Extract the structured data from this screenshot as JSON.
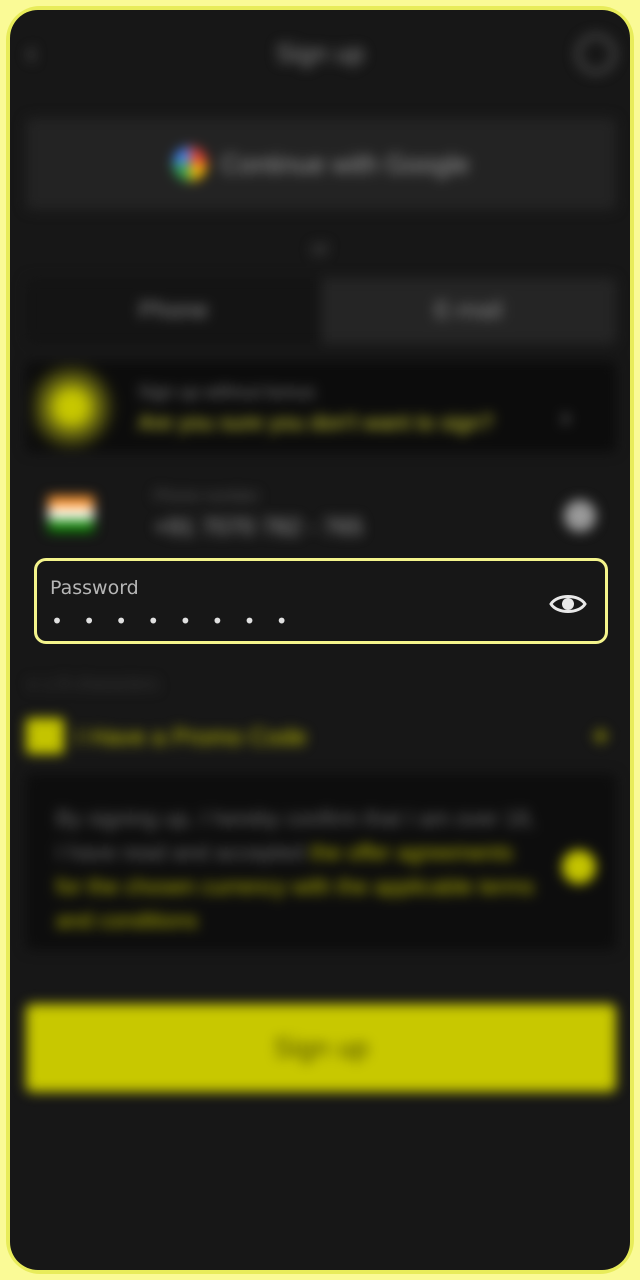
{
  "header": {
    "title": "Sign up",
    "back_icon": "chevron-left-icon",
    "support_icon": "support-icon"
  },
  "google_button": {
    "label": "Continue with Google",
    "icon": "google-icon"
  },
  "divider": {
    "label": "or"
  },
  "tabs": [
    {
      "label": "Phone",
      "active": true
    },
    {
      "label": "E-mail",
      "active": false
    }
  ],
  "promo_banner": {
    "title": "Sign up without bonus",
    "text": "Are you sure you don't want to sign?",
    "arrow": "›"
  },
  "phone": {
    "label": "Phone number",
    "value": "+91 7070 782 - 765",
    "flag": "india-flag-icon"
  },
  "password": {
    "label": "Password",
    "value": "• • • • • • • •",
    "toggle_icon": "eye-icon"
  },
  "strength": {
    "label": "∨  ≥ 8 characters"
  },
  "promo_code": {
    "label": "I Have a Promo Code",
    "plus": "+"
  },
  "terms": {
    "prefix": "By signing up, I hereby confirm that I am over 18, I have read and accepted ",
    "link": "the offer agreements for the chosen currency with the applicable terms and conditions"
  },
  "signup_button": {
    "label": "Sign up"
  },
  "colors": {
    "accent": "#c8c800",
    "background": "#171717",
    "highlight_border": "#f4f48c"
  }
}
